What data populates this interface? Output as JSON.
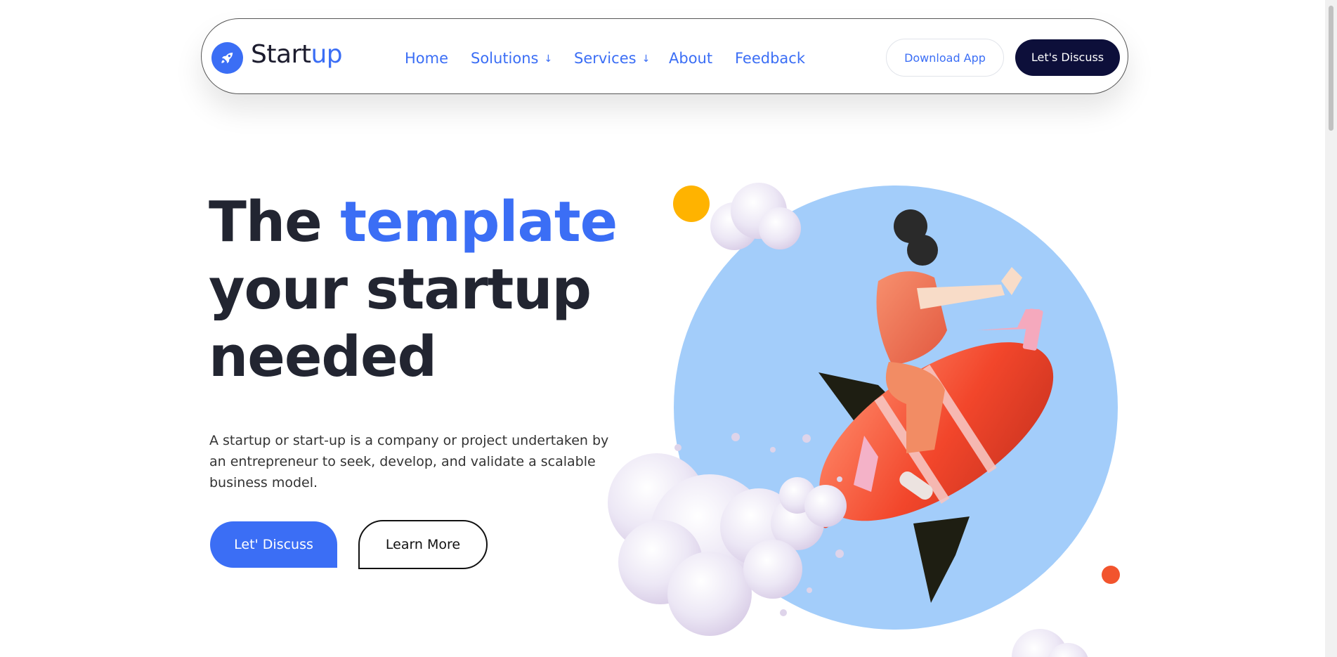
{
  "nav": {
    "logo_text_main": "Start",
    "logo_text_accent": "up",
    "links": [
      {
        "label": "Home"
      },
      {
        "label": "Solutions",
        "arrow": "↓"
      },
      {
        "label": "Services",
        "arrow": "↓"
      },
      {
        "label": "About"
      },
      {
        "label": "Feedback"
      }
    ],
    "download_label": "Download App",
    "discuss_label": "Let's Discuss"
  },
  "hero": {
    "title_part1": "The ",
    "title_accent": "template",
    "title_line2": "your startup",
    "title_line3": "needed",
    "description": "A startup or start-up is a company or project undertaken by an entrepreneur to seek, develop, and validate a scalable business model.",
    "primary_button": "Let' Discuss",
    "secondary_button": "Learn More"
  },
  "colors": {
    "accent": "#3b6ef5",
    "dark_button": "#0d0f3a",
    "circle": "#a3cdfa",
    "yellow_dot": "#ffb300",
    "red_dot": "#f2542d"
  },
  "icons": {
    "logo": "rocket-icon",
    "dropdown": "arrow-down-icon"
  }
}
